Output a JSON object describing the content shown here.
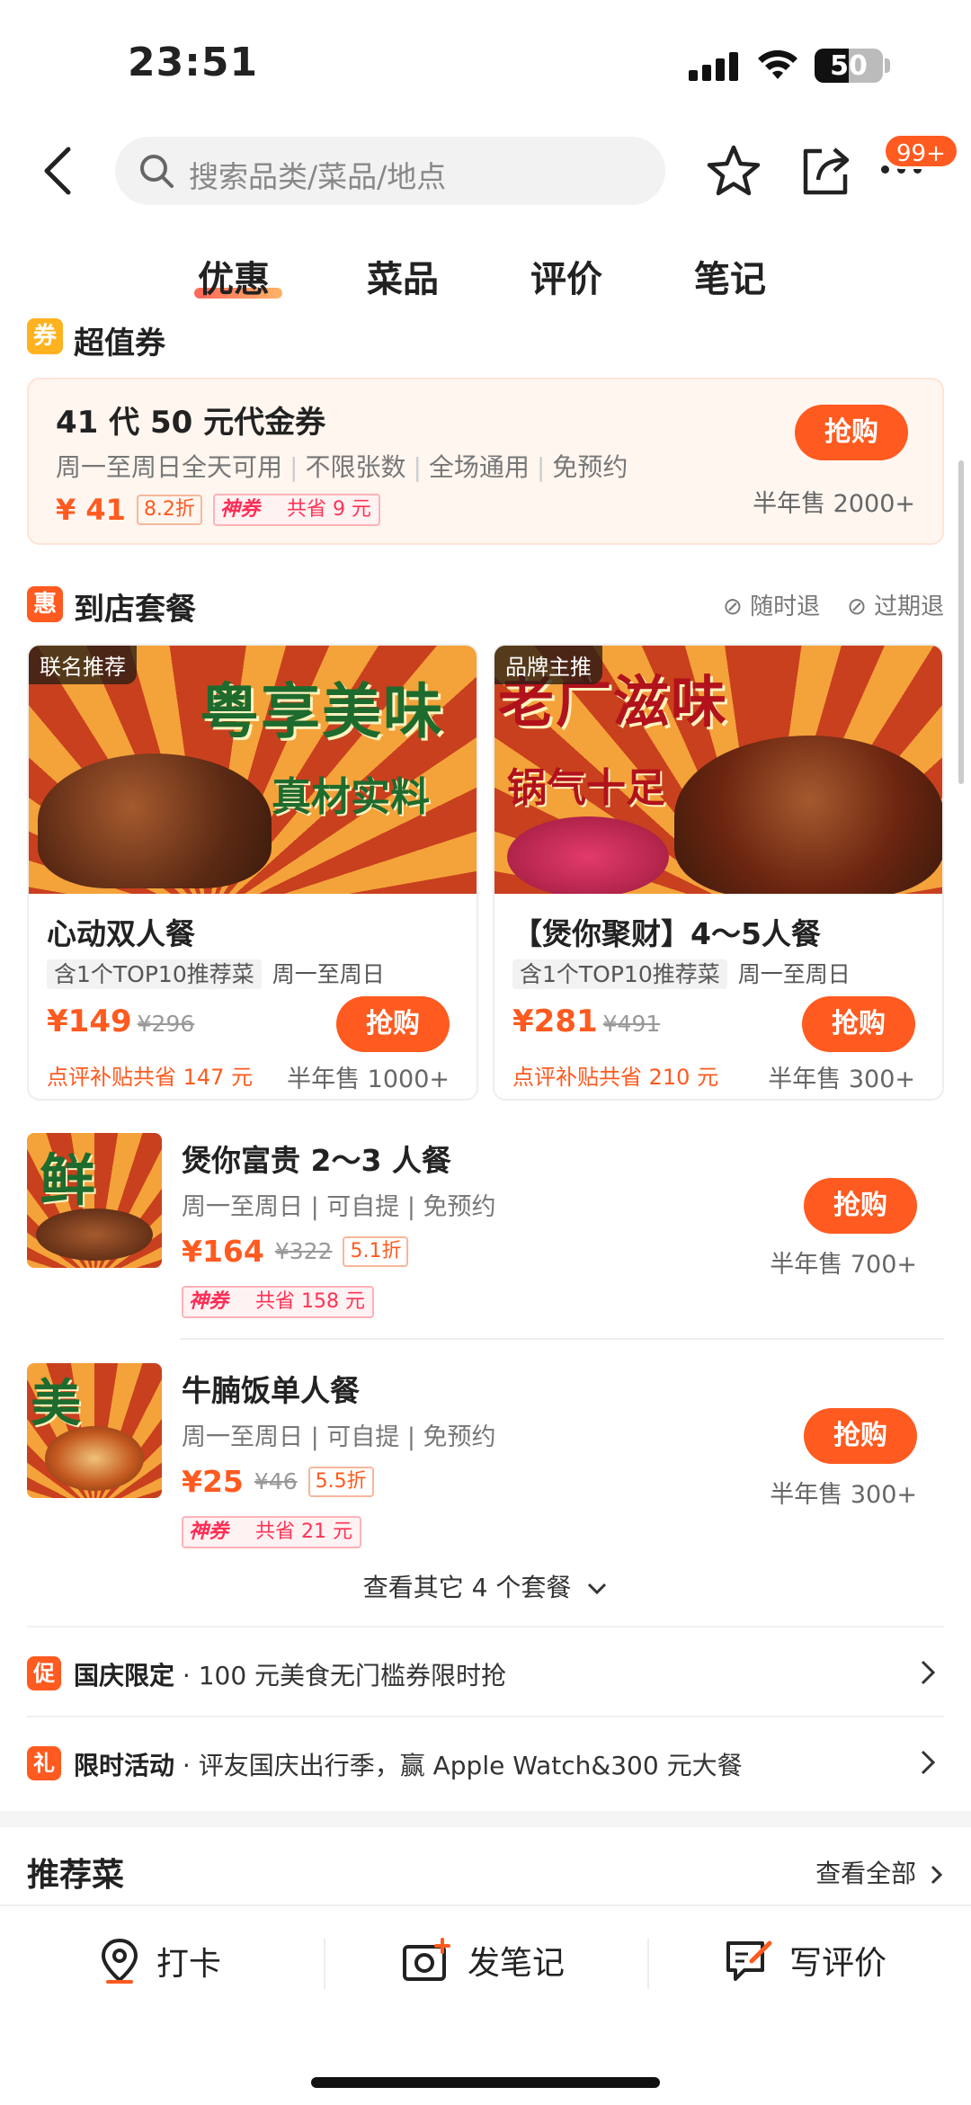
{
  "status": {
    "time": "23:51",
    "battery": "50"
  },
  "search": {
    "placeholder": "搜索品类/菜品/地点"
  },
  "header": {
    "badge": "99+"
  },
  "tabs": [
    "优惠",
    "菜品",
    "评价",
    "笔记"
  ],
  "voucher_section": {
    "icon": "券",
    "title": "超值券",
    "item": {
      "title": "41 代 50 元代金券",
      "desc": [
        "周一至周日全天可用",
        "不限张数",
        "全场通用",
        "免预约"
      ],
      "price": "¥ 41",
      "discount": "8.2折",
      "shenquan_brand": "神券",
      "shenquan_save": "共省 9 元",
      "buy": "抢购",
      "sold": "半年售 2000+"
    }
  },
  "package_section": {
    "icon": "惠",
    "title": "到店套餐",
    "checks": [
      "随时退",
      "过期退"
    ],
    "cards": [
      {
        "corner": "联名推荐",
        "img_text_1": "粤享美味",
        "img_text_2": "真材实料",
        "title": "心动双人餐",
        "tag": "含1个TOP10推荐菜",
        "days": "周一至周日",
        "price": "¥149",
        "orig": "¥296",
        "sub": "点评补贴共省 147 元",
        "buy": "抢购",
        "sold": "半年售 1000+"
      },
      {
        "corner": "品牌主推",
        "img_text_1": "老广滋味",
        "img_text_2": "锅气十足",
        "title": "【煲你聚财】4～5人餐",
        "tag": "含1个TOP10推荐菜",
        "days": "周一至周日",
        "price": "¥281",
        "orig": "¥491",
        "sub": "点评补贴共省 210 元",
        "buy": "抢购",
        "sold": "半年售 300+"
      }
    ],
    "rows": [
      {
        "img_char": "鲜",
        "title": "煲你富贵 2～3 人餐",
        "desc": "周一至周日 | 可自提 | 免预约",
        "price": "¥164",
        "orig": "¥322",
        "discount": "5.1折",
        "shenquan_brand": "神券",
        "shenquan_save": "共省 158 元",
        "buy": "抢购",
        "sold": "半年售 700+"
      },
      {
        "img_char": "美",
        "title": "牛腩饭单人餐",
        "desc": "周一至周日 | 可自提 | 免预约",
        "price": "¥25",
        "orig": "¥46",
        "discount": "5.5折",
        "shenquan_brand": "神券",
        "shenquan_save": "共省 21 元",
        "buy": "抢购",
        "sold": "半年售 300+"
      }
    ],
    "more": "查看其它 4 个套餐"
  },
  "promos": [
    {
      "icon": "促",
      "label": "国庆限定",
      "text": " · 100 元美食无门槛券限时抢"
    },
    {
      "icon": "礼",
      "label": "限时活动",
      "text": " · 评友国庆出行季，赢 Apple Watch&300 元大餐"
    }
  ],
  "recommend": {
    "title": "推荐菜",
    "more": "查看全部"
  },
  "bottom": {
    "checkin": "打卡",
    "note": "发笔记",
    "review": "写评价"
  },
  "colors": {
    "accent": "#ff5a1f",
    "shenquan": "#ff2d55"
  }
}
